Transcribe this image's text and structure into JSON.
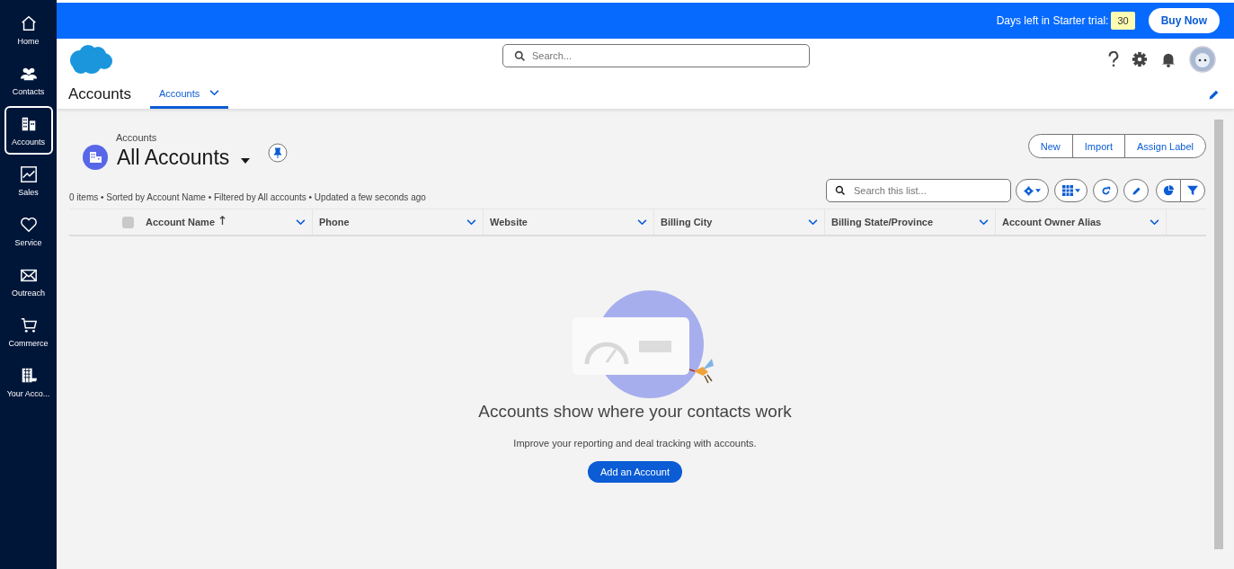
{
  "nav": [
    {
      "label": "Home",
      "selected": false
    },
    {
      "label": "Contacts",
      "selected": false
    },
    {
      "label": "Accounts",
      "selected": true
    },
    {
      "label": "Sales",
      "selected": false
    },
    {
      "label": "Service",
      "selected": false
    },
    {
      "label": "Outreach",
      "selected": false
    },
    {
      "label": "Commerce",
      "selected": false
    },
    {
      "label": "Your Acco...",
      "selected": false
    }
  ],
  "trial_bar": {
    "label": "Days left in Starter trial:",
    "days": "30",
    "button": "Buy Now"
  },
  "header": {
    "search": {
      "placeholder": "Search..."
    },
    "app_name": "Accounts",
    "tabs": [
      {
        "label": "Accounts",
        "selected": true
      }
    ]
  },
  "list_view": {
    "breadcrumb": "Accounts",
    "title": "All Accounts",
    "actions": [
      "New",
      "Import",
      "Assign Label"
    ],
    "status": "0 items • Sorted by Account Name • Filtered by All accounts • Updated a few seconds ago",
    "search": {
      "placeholder": "Search this list..."
    }
  },
  "table": {
    "select_all": {
      "checked": false
    },
    "columns": [
      {
        "label": "Account Name",
        "sorted": true
      },
      {
        "label": "Phone",
        "sorted": false
      },
      {
        "label": "Website",
        "sorted": false
      },
      {
        "label": "Billing City",
        "sorted": false
      },
      {
        "label": "Billing State/Province",
        "sorted": false
      },
      {
        "label": "Account Owner Alias",
        "sorted": false
      }
    ]
  },
  "empty_state": {
    "title": "Accounts show where your contacts work",
    "text": "Improve your reporting and deal tracking with accounts.",
    "button": "Add an Account"
  }
}
